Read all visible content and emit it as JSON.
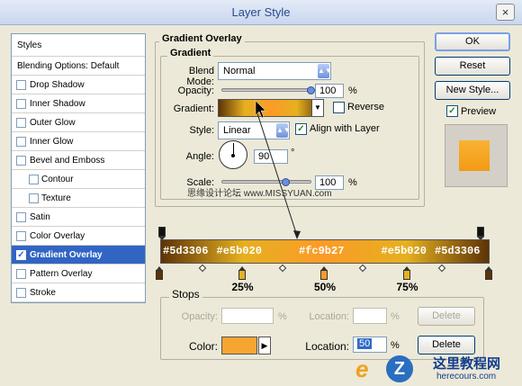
{
  "window": {
    "title": "Layer Style",
    "close_glyph": "×"
  },
  "left_panel": {
    "header": "Styles",
    "blending": "Blending Options: Default",
    "items": [
      {
        "label": "Drop Shadow",
        "checked": false,
        "sub": false
      },
      {
        "label": "Inner Shadow",
        "checked": false,
        "sub": false
      },
      {
        "label": "Outer Glow",
        "checked": false,
        "sub": false
      },
      {
        "label": "Inner Glow",
        "checked": false,
        "sub": false
      },
      {
        "label": "Bevel and Emboss",
        "checked": false,
        "sub": false
      },
      {
        "label": "Contour",
        "checked": false,
        "sub": true
      },
      {
        "label": "Texture",
        "checked": false,
        "sub": true
      },
      {
        "label": "Satin",
        "checked": false,
        "sub": false
      },
      {
        "label": "Color Overlay",
        "checked": false,
        "sub": false
      },
      {
        "label": "Gradient Overlay",
        "checked": true,
        "sub": false,
        "selected": true
      },
      {
        "label": "Pattern Overlay",
        "checked": false,
        "sub": false
      },
      {
        "label": "Stroke",
        "checked": false,
        "sub": false
      }
    ]
  },
  "panel": {
    "group_title": "Gradient Overlay",
    "sub_title": "Gradient",
    "blend_mode_label": "Blend Mode:",
    "blend_mode_value": "Normal",
    "opacity_label": "Opacity:",
    "opacity_value": "100",
    "opacity_unit": "%",
    "gradient_label": "Gradient:",
    "reverse_label": "Reverse",
    "style_label": "Style:",
    "style_value": "Linear",
    "align_label": "Align with Layer",
    "angle_label": "Angle:",
    "angle_value": "90",
    "angle_unit": "°",
    "scale_label": "Scale:",
    "scale_value": "100",
    "scale_unit": "%",
    "opacity_level": 1.0,
    "scale_level": 0.72
  },
  "buttons": {
    "ok": "OK",
    "reset": "Reset",
    "new_style": "New Style...",
    "preview": "Preview"
  },
  "watermark": {
    "text": "思缘设计论坛 www.MISSYUAN.com"
  },
  "gradient": {
    "stops": [
      {
        "label": "#5d3306",
        "color": "#5d3306"
      },
      {
        "label": "#e5b020",
        "color": "#e5b020"
      },
      {
        "label": "#fc9b27",
        "color": "#fc9b27"
      },
      {
        "label": "#e5b020",
        "color": "#e5b020"
      },
      {
        "label": "#5d3306",
        "color": "#5d3306"
      }
    ],
    "percents": [
      "25%",
      "50%",
      "75%"
    ]
  },
  "stops_panel": {
    "title": "Stops",
    "opacity_label": "Opacity:",
    "opacity_unit": "%",
    "location_label": "Location:",
    "location_unit": "%",
    "delete_label": "Delete",
    "color_label": "Color:",
    "color_value": "#f7a531",
    "location2_label": "Location:",
    "location2_value": "50",
    "location2_unit": "%",
    "delete2_label": "Delete"
  },
  "logo": {
    "text": "这里教程网",
    "url_text": "herecours.com"
  }
}
